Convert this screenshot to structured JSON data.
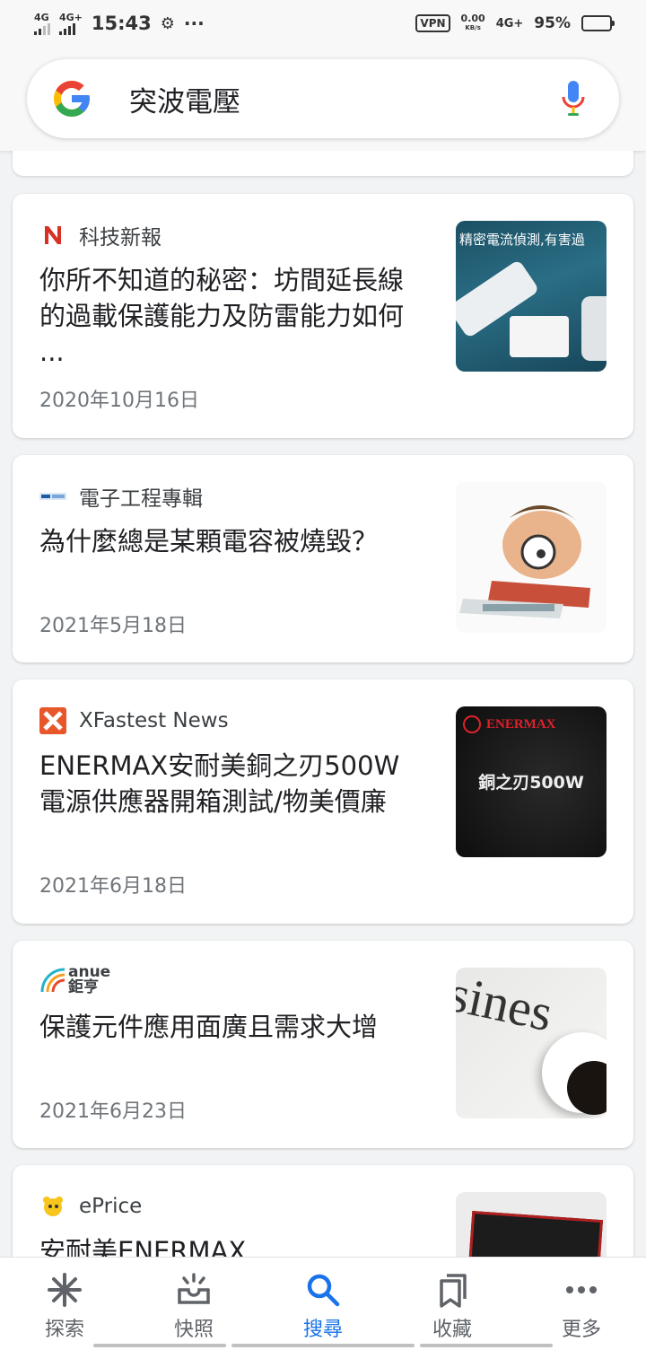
{
  "status_bar": {
    "net1": "4G",
    "net2": "4G+",
    "time": "15:43",
    "vpn": "VPN",
    "speed_value": "0.00",
    "speed_unit": "KB/s",
    "net3": "4G+",
    "battery": "95%",
    "battery_level": 0.95
  },
  "search": {
    "query": "突波電壓"
  },
  "cards": [
    {
      "source": "科技新報",
      "logo": "n-logo",
      "headline": "你所不知道的秘密：坊間延長線的過載保護能力及防雷能力如何 ...",
      "date": "2020年10月16日",
      "thumb_caption": "精密電流偵測,有害過"
    },
    {
      "source": "電子工程專輯",
      "logo": "ee-times-logo",
      "headline": "為什麼總是某顆電容被燒毀？",
      "date": "2021年5月18日"
    },
    {
      "source": "XFastest News",
      "logo": "xfastest-logo",
      "headline": "ENERMAX安耐美銅之刃500W電源供應器開箱測試/物美價廉",
      "date": "2021年6月18日",
      "thumb_brand": "ENERMAX",
      "thumb_caption": "銅之刃500W"
    },
    {
      "source": "anue\n鉅亨",
      "logo": "anue-logo",
      "headline": "保護元件應用面廣且需求大增",
      "date": "2021年6月23日",
      "thumb_caption": "sines"
    },
    {
      "source": "ePrice",
      "logo": "eprice-logo",
      "headline": "安耐美ENERMAX",
      "date": ""
    }
  ],
  "nav": [
    {
      "label": "探索",
      "icon": "asterisk-icon"
    },
    {
      "label": "快照",
      "icon": "snapshot-icon"
    },
    {
      "label": "搜尋",
      "icon": "search-icon"
    },
    {
      "label": "收藏",
      "icon": "collections-icon"
    },
    {
      "label": "更多",
      "icon": "more-icon"
    }
  ],
  "colors": {
    "accent": "#1a73e8",
    "g_blue": "#4285f4",
    "g_red": "#ea4335",
    "g_yellow": "#fbbc05",
    "g_green": "#34a853"
  }
}
